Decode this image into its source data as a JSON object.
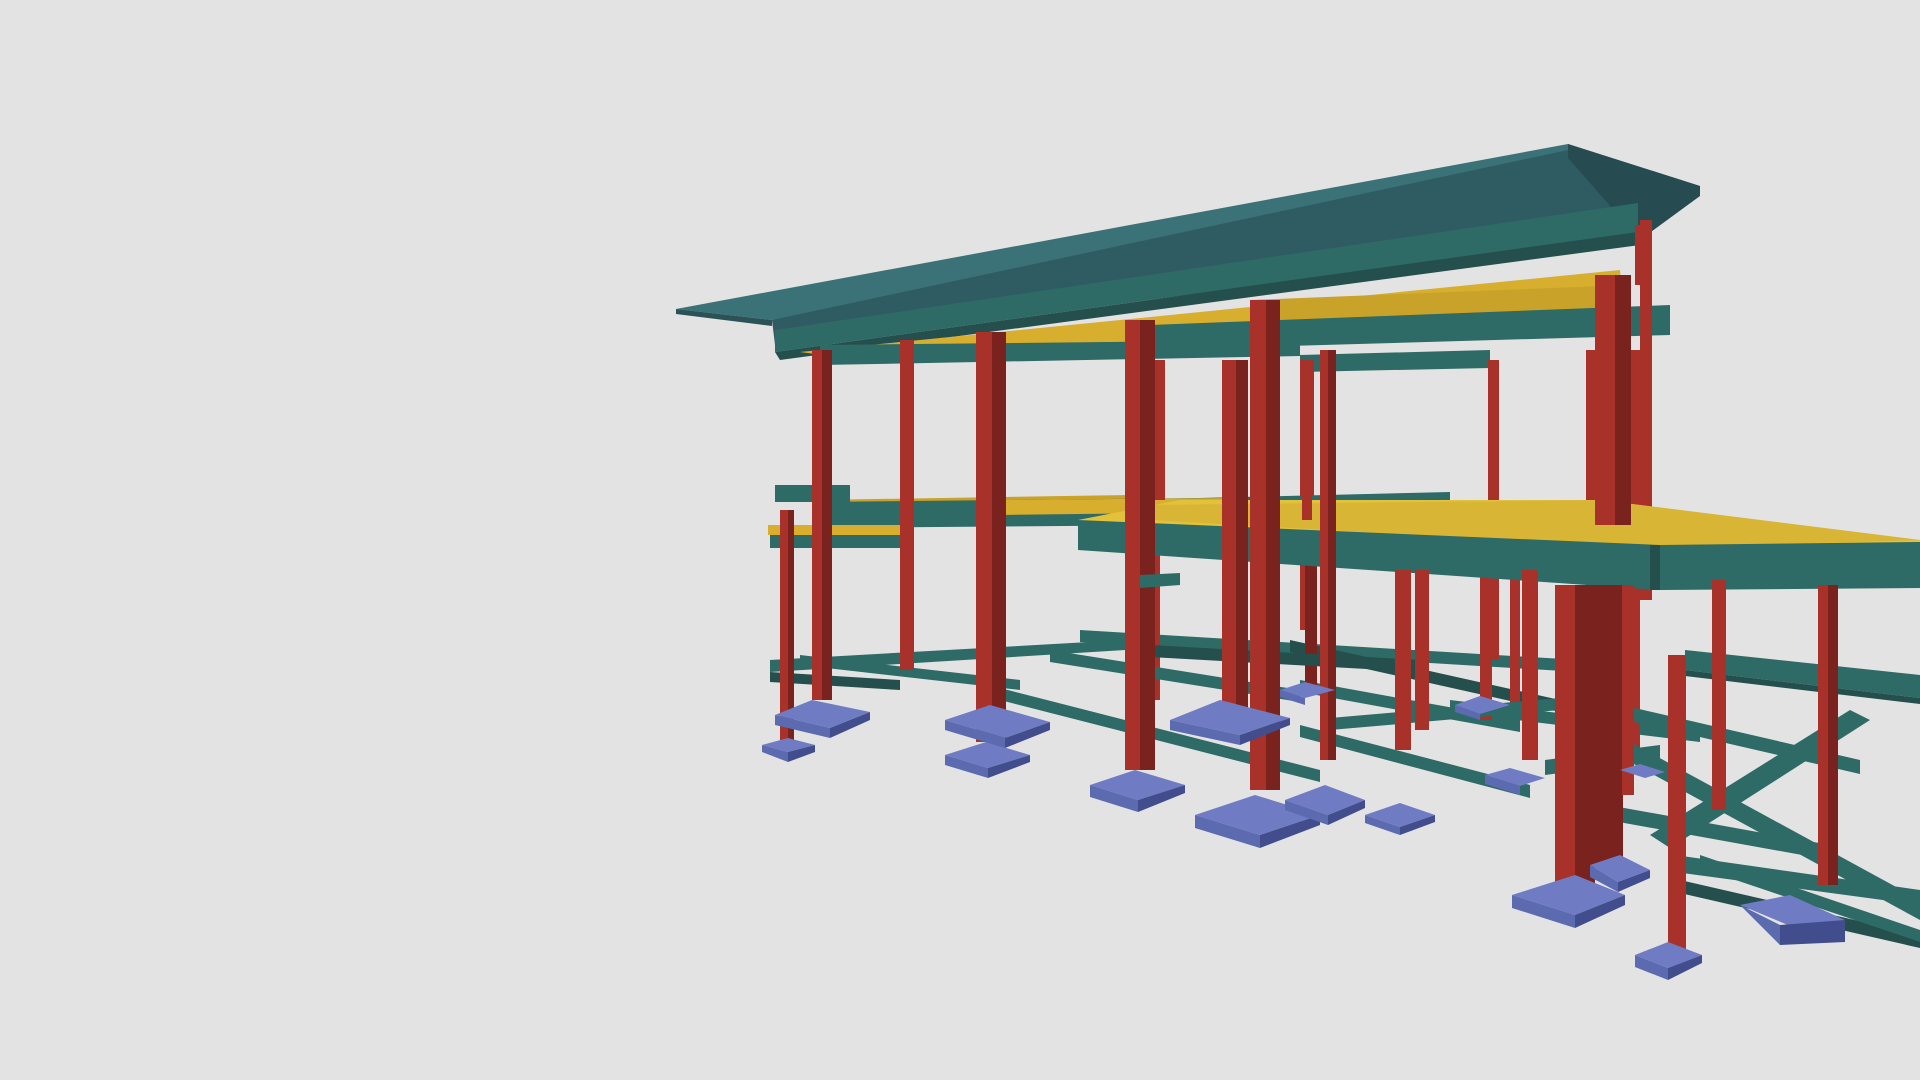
{
  "scene": {
    "background": "#e3e3e3",
    "colors": {
      "roof": "#2f5c62",
      "roof_top": "#3a7278",
      "beam": "#2e6a66",
      "beam_dark": "#244f4c",
      "slab": "#d7ae2e",
      "slab_bright": "#e2c23a",
      "column": "#a8322a",
      "column_dark": "#7a231e",
      "footing": "#5c6ab0",
      "footing_dark": "#414d8c"
    },
    "components": [
      "roof",
      "roof-beams",
      "upper-slab",
      "floor-slab",
      "floor-beams",
      "columns",
      "ground-beams",
      "footings"
    ]
  }
}
